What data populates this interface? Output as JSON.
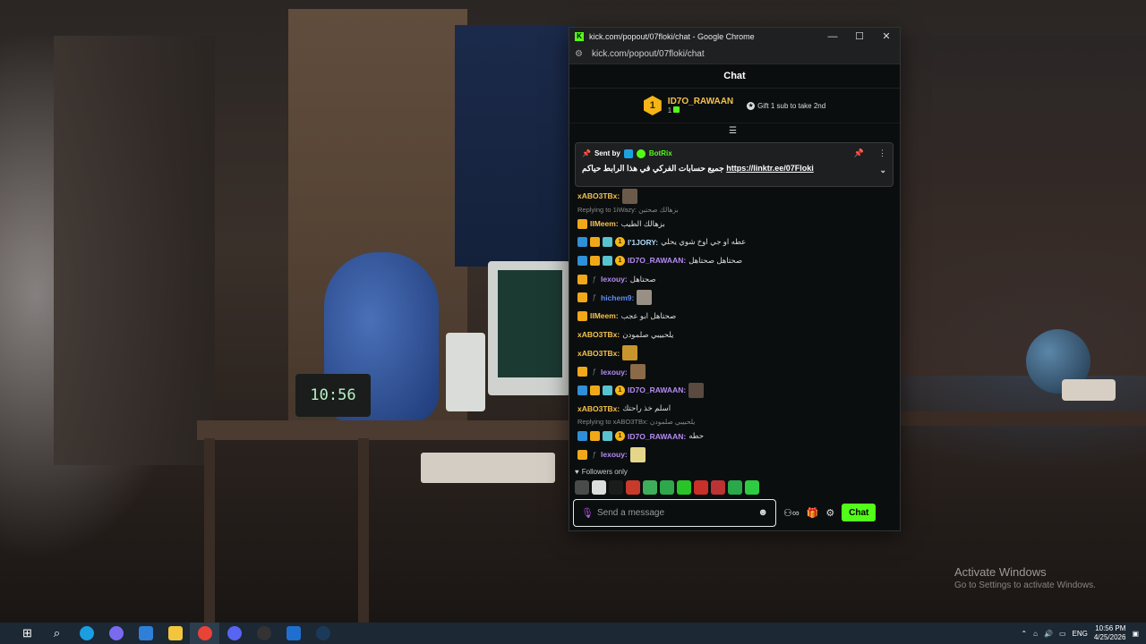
{
  "desktop": {
    "wallpaper_clock": "10:56",
    "activate_windows_title": "Activate Windows",
    "activate_windows_subtitle": "Go to Settings to activate Windows."
  },
  "window": {
    "title": "kick.com/popout/07floki/chat - Google Chrome",
    "url": "kick.com/popout/07floki/chat",
    "minimize": "—",
    "maximize": "☐",
    "close": "✕"
  },
  "chat": {
    "header": "Chat",
    "leaderboard": {
      "rank": "1",
      "name": "ID7O_RAWAAN",
      "count": "1",
      "gift_text": "Gift 1 sub to take 2nd"
    },
    "pinned": {
      "sent_by": "Sent by",
      "sender": "BotRix",
      "message_ar": "جميع حسابات الفركي في هذا الرابط حياكم",
      "link": "https://linktr.ee/07Floki"
    },
    "messages": [
      {
        "user": "xABO3TBx:",
        "text": "",
        "color": "u-y",
        "badges": [],
        "emote": "#6b5a4a"
      },
      {
        "reply": "Replying to 1iWazy: بزهالك صحتين",
        "user": "IIMeem:",
        "text": "بزهالك الطيب",
        "color": "u-y",
        "badges": [
          "crown"
        ]
      },
      {
        "user": "I'1JORY:",
        "text": "عطه او جي اوخ شوي يحلي",
        "color": "u-c",
        "badges": [
          "blue",
          "crown",
          "sub",
          "one"
        ]
      },
      {
        "user": "ID7O_RAWAAN:",
        "text": "صحتاهل صحتاهل",
        "color": "u-p",
        "badges": [
          "blue",
          "crown",
          "sub",
          "one"
        ]
      },
      {
        "user": "lexouy:",
        "text": "صحتاهل",
        "color": "u-p",
        "badges": [
          "crown",
          "f"
        ]
      },
      {
        "user": "hichem9:",
        "text": "",
        "color": "u-b",
        "badges": [
          "crown",
          "f"
        ],
        "emote": "#9a8f85"
      },
      {
        "user": "IIMeem:",
        "text": "صحتاهل ابو عجب",
        "color": "u-y",
        "badges": [
          "crown"
        ]
      },
      {
        "user": "xABO3TBx:",
        "text": "يلحبيبي صلمودن",
        "color": "u-y",
        "badges": []
      },
      {
        "user": "xABO3TBx:",
        "text": "",
        "color": "u-y",
        "badges": [],
        "emote": "#c8952c"
      },
      {
        "user": "lexouy:",
        "text": "",
        "color": "u-p",
        "badges": [
          "crown",
          "f"
        ],
        "emote": "#8a6a48"
      },
      {
        "user": "ID7O_RAWAAN:",
        "text": "",
        "color": "u-p",
        "badges": [
          "blue",
          "crown",
          "sub",
          "one"
        ],
        "emote": "#5a4a40"
      },
      {
        "user": "xABO3TBx:",
        "text": "اسلم خذ راحتك",
        "color": "u-y",
        "badges": []
      },
      {
        "reply": "Replying to xABO3TBx: يلحبيبي صلمودن",
        "user": "ID7O_RAWAAN:",
        "text": "حطه",
        "color": "u-p",
        "badges": [
          "blue",
          "crown",
          "sub",
          "one"
        ]
      },
      {
        "user": "lexouy:",
        "text": "",
        "color": "u-p",
        "badges": [
          "crown",
          "f"
        ],
        "emote": "#e6d68a"
      }
    ],
    "followers_only": "Followers only",
    "emote_colors": [
      "#4a4a4a",
      "#ddd",
      "#1b1b1b",
      "#c83a2a",
      "#3fae5a",
      "#2ea84a",
      "#28c428",
      "#c8302a",
      "#bb3333",
      "#2aa84a",
      "#2ecc40"
    ],
    "input_placeholder": "Send a message",
    "send_button": "Chat"
  },
  "taskbar": {
    "language": "ENG",
    "time": "10:56 PM",
    "date": "4/25/2026"
  }
}
